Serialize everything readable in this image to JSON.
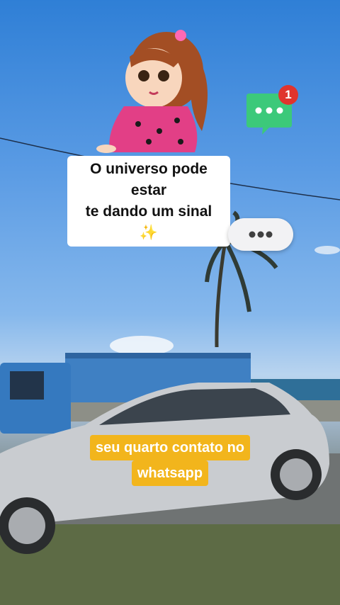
{
  "scene": {
    "top_caption": {
      "line1": "O universo pode estar",
      "line2": "te dando um sinal ✨"
    },
    "bottom_caption": {
      "line1": "seu quarto contato no",
      "line2": "whatsapp"
    },
    "chat_bubble_icon": {
      "icon": "chat-bubble-icon",
      "color": "#3cc97a",
      "badge_count": "1",
      "badge_color": "#e0342d"
    },
    "typing_bubble": {
      "icon": "typing-dots-icon",
      "color": "#f2f2f4"
    },
    "illustration": "girl-cartoon-sticker",
    "background": "road-scene-with-car-truck-palm-tree"
  }
}
